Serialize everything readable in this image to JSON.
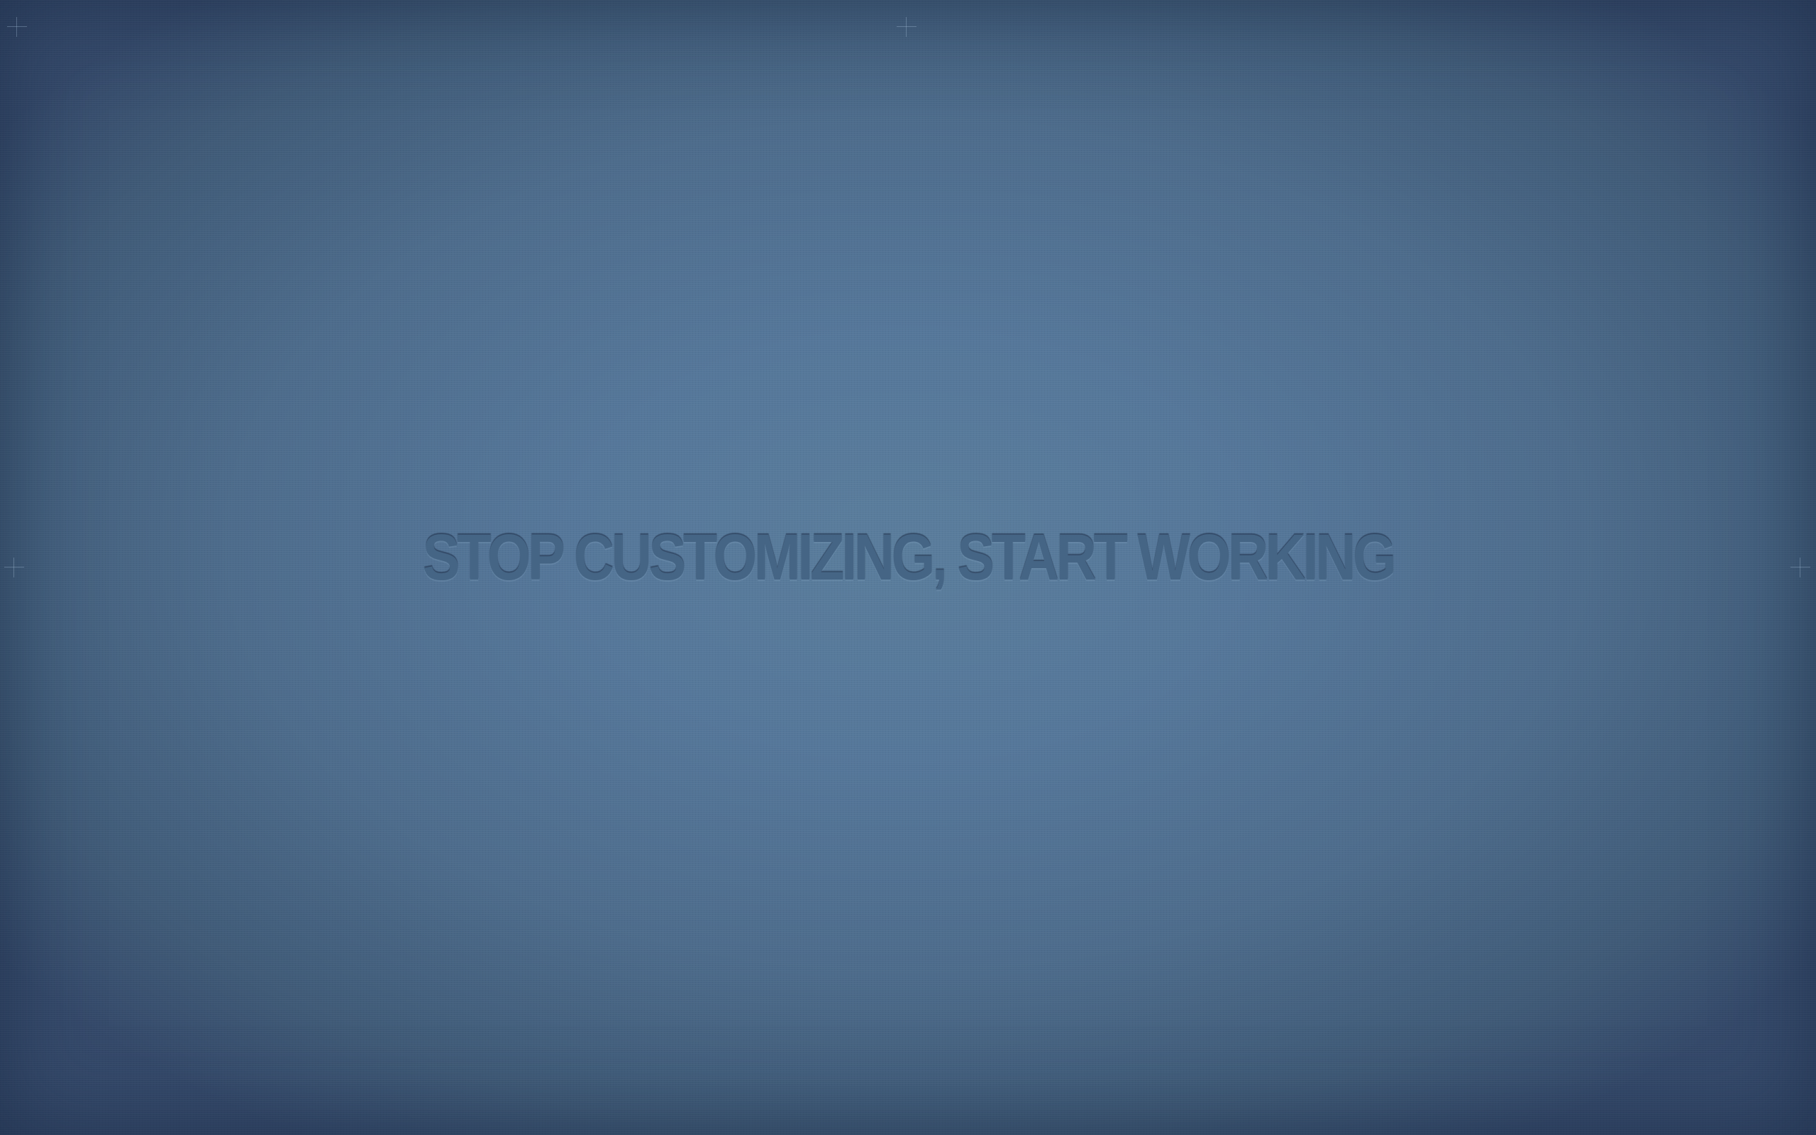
{
  "wallpaper": {
    "message": "STOP CUSTOMIZING, START WORKING",
    "colors": {
      "background_center": "#5a7d9c",
      "background_edge": "#34496a",
      "text": "#456585"
    },
    "decorations": [
      "crosshair-icon",
      "crosshair-icon",
      "crosshair-icon",
      "crosshair-icon"
    ]
  }
}
